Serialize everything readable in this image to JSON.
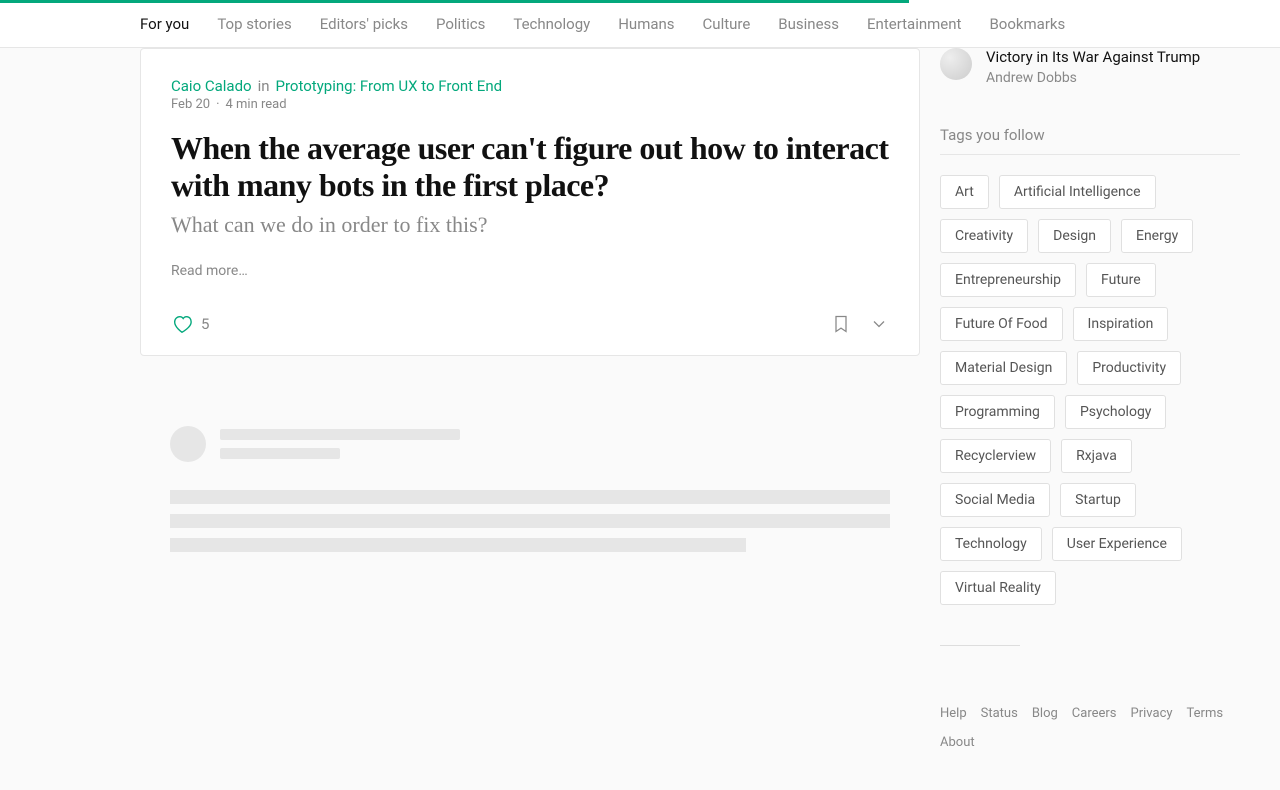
{
  "nav": {
    "items": [
      "For you",
      "Top stories",
      "Editors' picks",
      "Politics",
      "Technology",
      "Humans",
      "Culture",
      "Business",
      "Entertainment",
      "Bookmarks"
    ],
    "active": 0
  },
  "article": {
    "author": "Caio Calado",
    "in": "in",
    "publication": "Prototyping: From UX to Front End",
    "date": "Feb 20",
    "readtime": "4 min read",
    "title": "When the average user can't figure out how to interact with many bots in the first place?",
    "subtitle": "What can we do in order to fix this?",
    "read_more": "Read more…",
    "likes": "5"
  },
  "reading": {
    "item": {
      "title": "Victory in Its War Against Trump",
      "author": "Andrew Dobbs"
    }
  },
  "tags_title": "Tags you follow",
  "tags": [
    "Art",
    "Artificial Intelligence",
    "Creativity",
    "Design",
    "Energy",
    "Entrepreneurship",
    "Future",
    "Future Of Food",
    "Inspiration",
    "Material Design",
    "Productivity",
    "Programming",
    "Psychology",
    "Recyclerview",
    "Rxjava",
    "Social Media",
    "Startup",
    "Technology",
    "User Experience",
    "Virtual Reality"
  ],
  "footer": [
    "Help",
    "Status",
    "Blog",
    "Careers",
    "Privacy",
    "Terms",
    "About"
  ]
}
